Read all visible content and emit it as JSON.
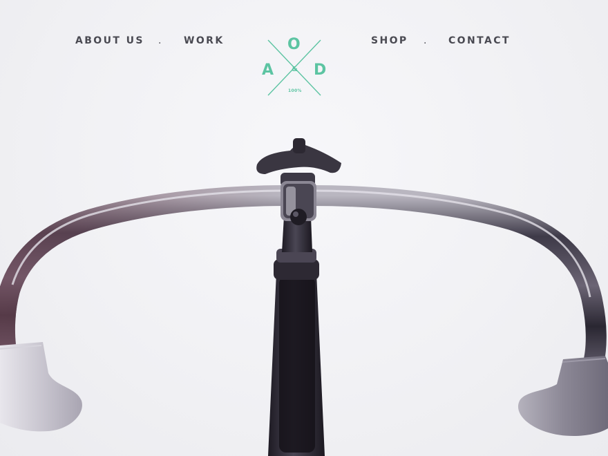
{
  "nav": {
    "left": [
      {
        "label": "ABOUT US"
      },
      {
        "label": "WORK"
      }
    ],
    "right": [
      {
        "label": "SHOP"
      },
      {
        "label": "CONTACT"
      }
    ],
    "separator": "."
  },
  "logo": {
    "top_letter": "O",
    "left_letter": "A",
    "right_letter": "D",
    "ampersand": "&",
    "caption": "100%",
    "color": "#5cc4a2"
  },
  "hero": {
    "image_icon": "bicycle-handlebar-icon"
  }
}
